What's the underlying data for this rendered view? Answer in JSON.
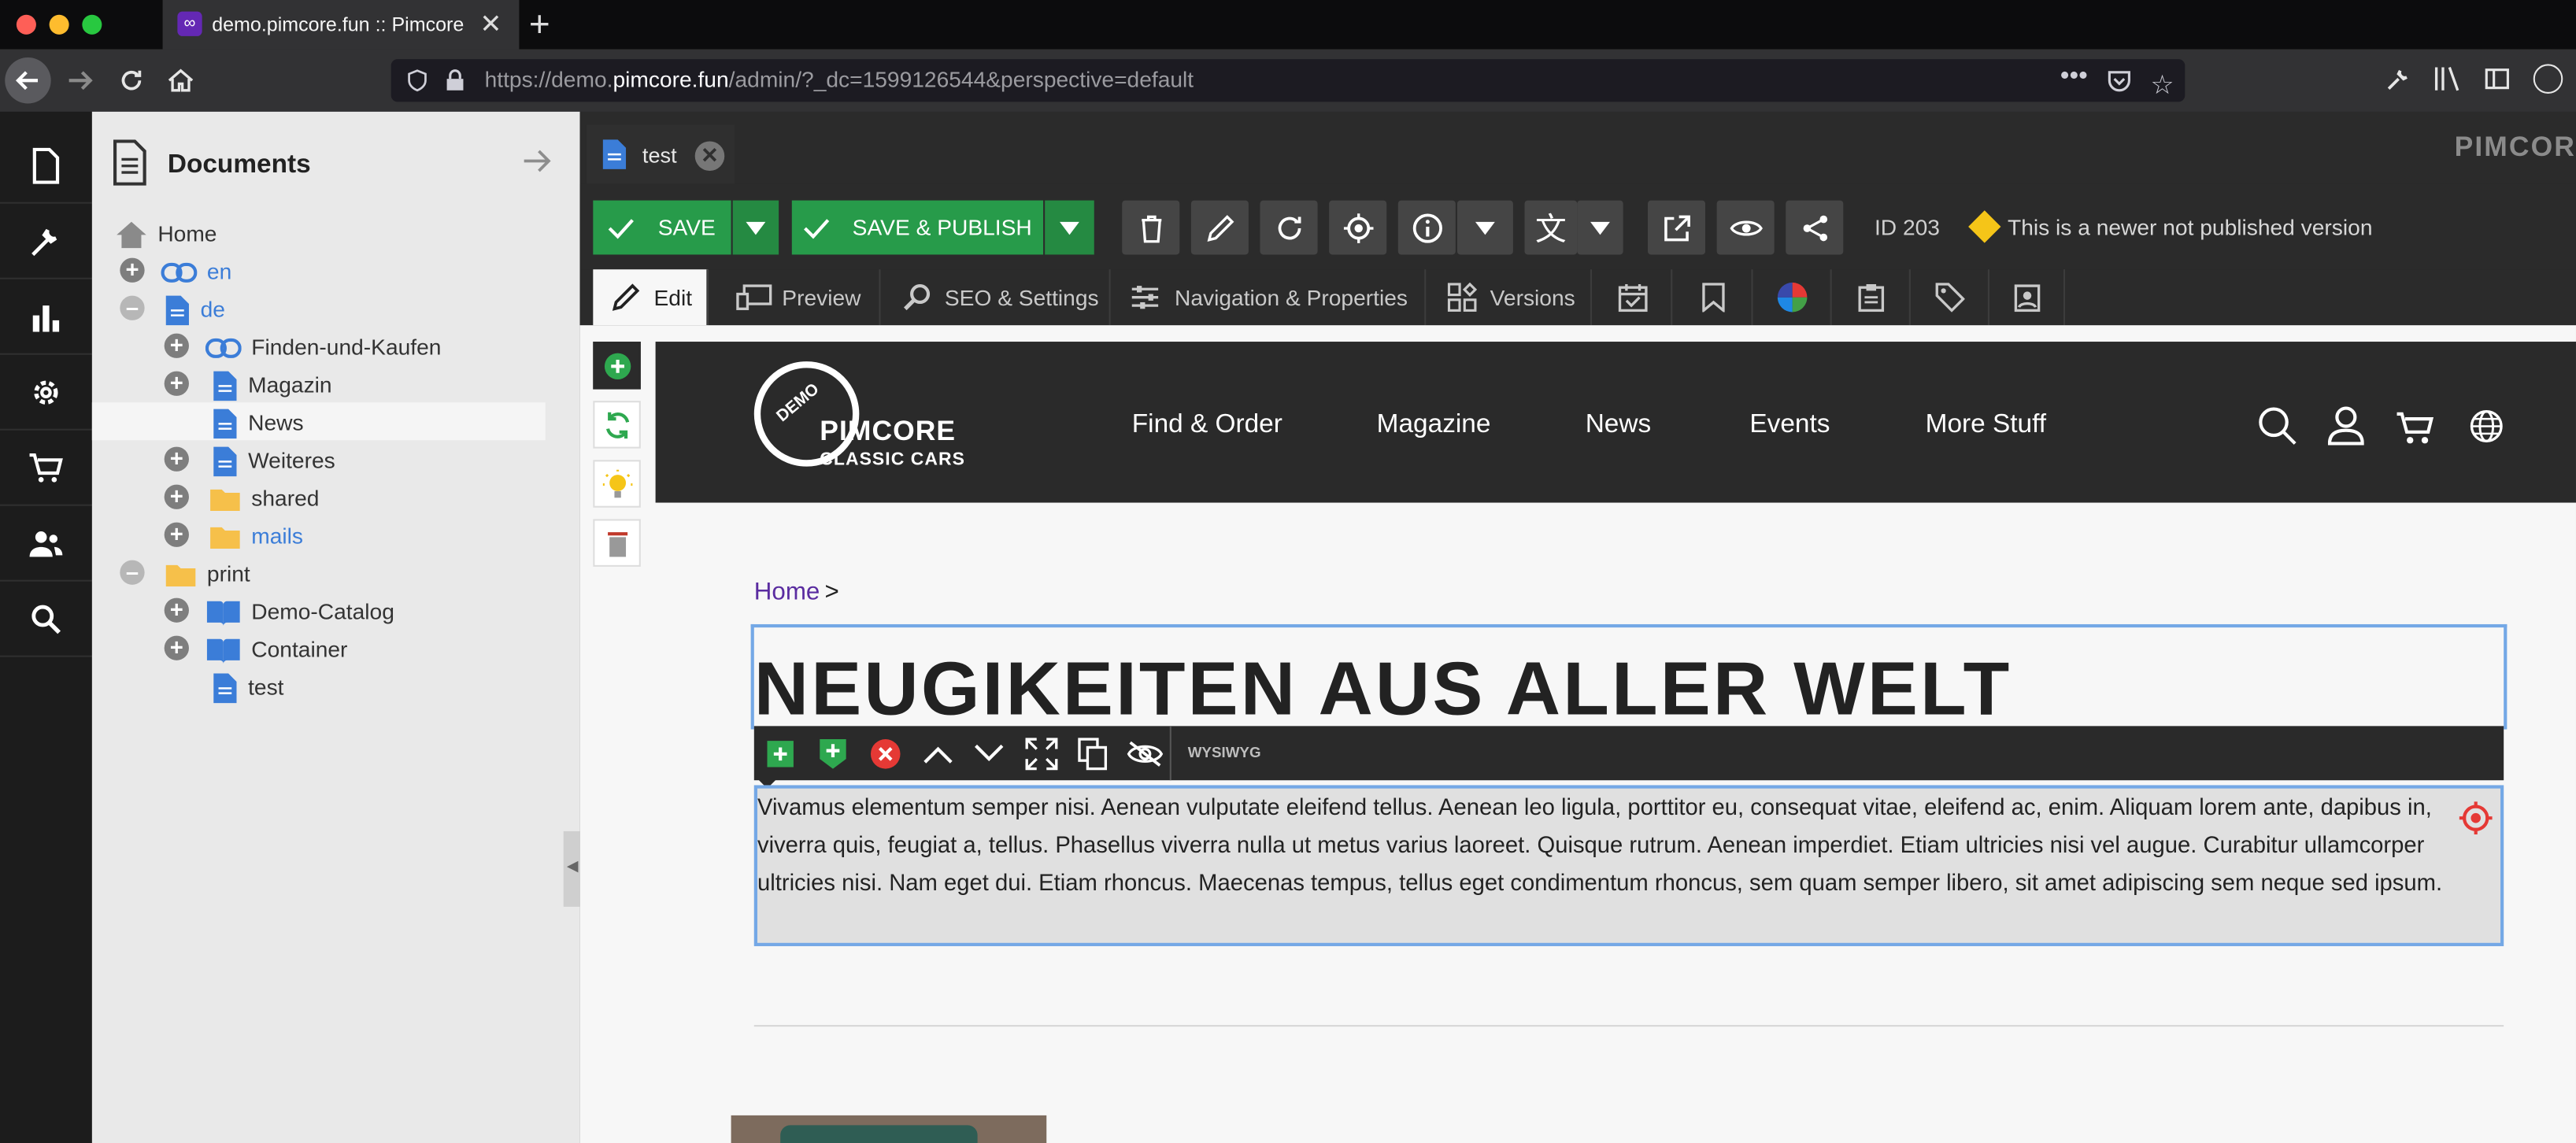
{
  "browser": {
    "tab_title": "demo.pimcore.fun :: Pimcore",
    "url_prefix": "https://demo.",
    "url_domain": "pimcore.fun",
    "url_path": "/admin/?_dc=1599126544&perspective=default"
  },
  "brand_mark": "PIMCORE",
  "panel": {
    "title": "Documents"
  },
  "tree": [
    {
      "label": "Home",
      "link": false
    },
    {
      "label": "en",
      "link": true
    },
    {
      "label": "de",
      "link": true
    },
    {
      "label": "Finden-und-Kaufen",
      "link": false
    },
    {
      "label": "Magazin",
      "link": false
    },
    {
      "label": "News",
      "link": false
    },
    {
      "label": "Weiteres",
      "link": false
    },
    {
      "label": "shared",
      "link": false
    },
    {
      "label": "mails",
      "link": true
    },
    {
      "label": "print",
      "link": false
    },
    {
      "label": "Demo-Catalog",
      "link": false
    },
    {
      "label": "Container",
      "link": false
    },
    {
      "label": "test",
      "link": false
    }
  ],
  "doc_tab": {
    "label": "test"
  },
  "toolbar": {
    "save_label": "SAVE",
    "save_publish_label": "SAVE & PUBLISH",
    "id_label": "ID 203",
    "status_text": "This is a newer not published version"
  },
  "subtabs": {
    "edit": "Edit",
    "preview": "Preview",
    "seo": "SEO & Settings",
    "nav": "Navigation & Properties",
    "versions": "Versions"
  },
  "site": {
    "logo_top": "PIMCORE",
    "logo_sub": "CLASSIC CARS",
    "logo_badge": "DEMO",
    "menu": [
      "Find & Order",
      "Magazine",
      "News",
      "Events",
      "More Stuff"
    ]
  },
  "content": {
    "breadcrumb_home": "Home",
    "breadcrumb_sep": ">",
    "heading": "NEUGIKEITEN AUS ALLER WELT",
    "editor_type": "WYSIWYG",
    "paragraph": "Vivamus elementum semper nisi. Aenean vulputate eleifend tellus. Aenean leo ligula, porttitor eu, consequat vitae, eleifend ac, enim. Aliquam lorem ante, dapibus in, viverra quis, feugiat a, tellus. Phasellus viverra nulla ut metus varius laoreet. Quisque rutrum. Aenean imperdiet. Etiam ultricies nisi vel augue. Curabitur ullamcorper ultricies nisi. Nam eget dui. Etiam rhoncus. Maecenas tempus, tellus eget condimentum rhoncus, sem quam semper libero, sit amet adipiscing sem neque sed ipsum."
  },
  "colors": {
    "save_green": "#279b4a",
    "focus_blue": "#74a8e6",
    "warning_yellow": "#f5c518"
  }
}
